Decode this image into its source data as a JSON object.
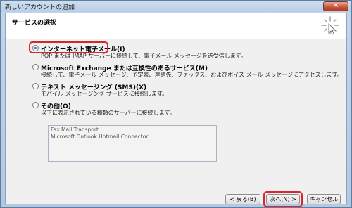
{
  "window": {
    "title": "新しいアカウントの追加",
    "close_glyph": "✕"
  },
  "header": {
    "title": "サービスの選択"
  },
  "options": [
    {
      "label": "インターネット電子メール(I)",
      "description": "POP または IMAP サーバーに接続して、電子メール メッセージを送受信します。",
      "selected": true
    },
    {
      "label": "Microsoft Exchange または互換性のあるサービス(M)",
      "description": "接続して、電子メール メッセージ、予定表、連絡先、ファックス、およびボイス メール メッセージにアクセスします。",
      "selected": false
    },
    {
      "label": "テキスト メッセージング (SMS)(X)",
      "description": "モバイル メッセージング サービスに接続します。",
      "selected": false
    },
    {
      "label": "その他(O)",
      "description": "以下に表示されている種類のサーバーに接続します。",
      "selected": false
    }
  ],
  "other_servers": [
    "Fax Mail Transport",
    "Microsoft Outlook Hotmail Connector"
  ],
  "buttons": {
    "back": "< 戻る(B)",
    "next": "次へ(N) >",
    "cancel": "キャンセル"
  },
  "colors": {
    "highlight": "#d9262c",
    "title_bar": "#b9cde6",
    "close_button": "#c9523a"
  },
  "icons": {
    "wizard": "wizard-sparkle-icon"
  }
}
